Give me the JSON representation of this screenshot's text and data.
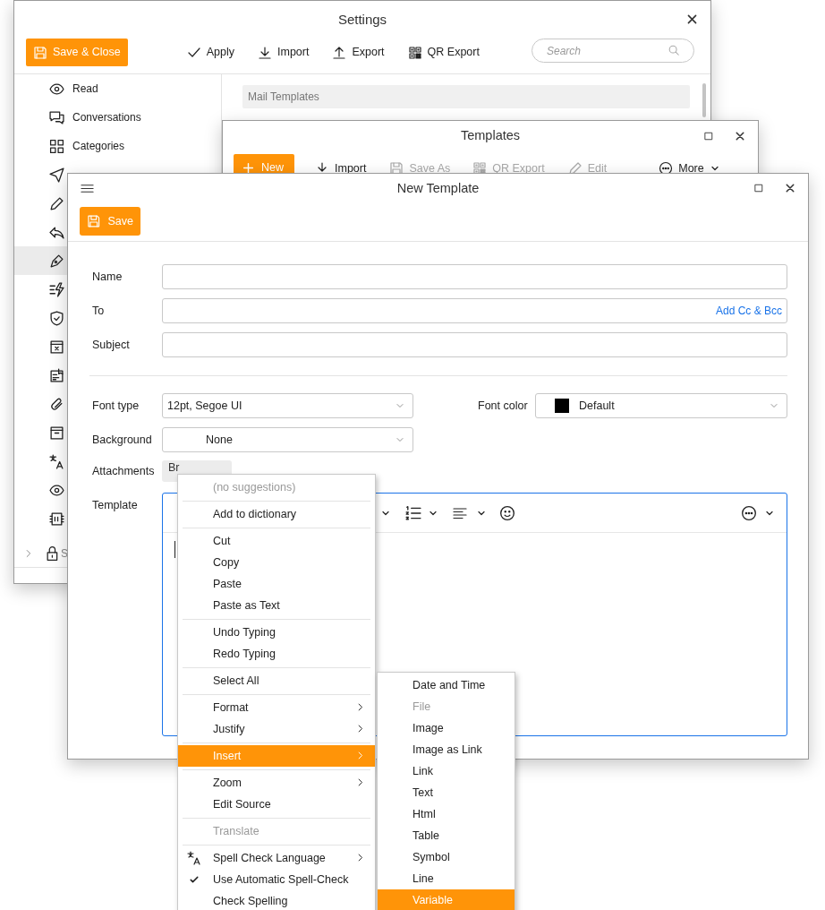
{
  "settings_window": {
    "title": "Settings",
    "save_button": "Save & Close",
    "toolbar": [
      "Apply",
      "Import",
      "Export",
      "QR Export"
    ],
    "search": {
      "placeholder": "Search"
    },
    "sidebar": {
      "items": [
        {
          "kind": "item",
          "label": "Read",
          "selected": false
        },
        {
          "kind": "item",
          "label": "Conversations",
          "selected": false
        },
        {
          "kind": "item",
          "label": "Categories",
          "selected": false
        },
        {
          "kind": "item",
          "selected": false
        },
        {
          "kind": "item",
          "selected": false
        },
        {
          "kind": "item",
          "selected": false
        },
        {
          "kind": "item",
          "selected": true
        },
        {
          "kind": "item",
          "selected": false
        },
        {
          "kind": "item",
          "selected": false
        },
        {
          "kind": "item",
          "selected": false
        },
        {
          "kind": "item",
          "selected": false
        },
        {
          "kind": "item",
          "selected": false
        },
        {
          "kind": "item",
          "selected": false
        },
        {
          "kind": "item",
          "selected": false
        },
        {
          "kind": "item",
          "selected": false
        },
        {
          "kind": "item",
          "selected": false
        },
        {
          "kind": "group",
          "label": "S",
          "selected": false
        }
      ]
    },
    "section_header": "Mail Templates"
  },
  "templates_window": {
    "title": "Templates",
    "new_button": "New",
    "toolbar": [
      {
        "label": "Import",
        "disabled": false
      },
      {
        "label": "Save As",
        "disabled": true
      },
      {
        "label": "QR Export",
        "disabled": true
      },
      {
        "label": "Edit",
        "disabled": true
      },
      {
        "label": "More",
        "disabled": false
      }
    ]
  },
  "new_template_window": {
    "title": "New Template",
    "save_button": "Save",
    "fields": [
      {
        "label": "Name"
      },
      {
        "label": "To",
        "link": "Add Cc & Bcc"
      },
      {
        "label": "Subject"
      }
    ],
    "font_type": {
      "label": "Font type",
      "value": "12pt, Segoe UI"
    },
    "font_color": {
      "label": "Font color",
      "value": "Default",
      "color": "#000000"
    },
    "background": {
      "label": "Background",
      "value": "None"
    },
    "attachments": {
      "label": "Attachments",
      "button": "Br"
    },
    "template": {
      "label": "Template"
    }
  },
  "context_menu": {
    "items": [
      {
        "kind": "item",
        "label": "(no suggestions)",
        "disabled": true,
        "selected": false,
        "checked": false,
        "submenu": false
      },
      {
        "kind": "separator"
      },
      {
        "kind": "item",
        "label": "Add to dictionary",
        "disabled": false,
        "selected": false,
        "checked": false,
        "submenu": false
      },
      {
        "kind": "separator"
      },
      {
        "kind": "item",
        "label": "Cut",
        "disabled": false,
        "selected": false,
        "checked": false,
        "submenu": false
      },
      {
        "kind": "item",
        "label": "Copy",
        "disabled": false,
        "selected": false,
        "checked": false,
        "submenu": false
      },
      {
        "kind": "item",
        "label": "Paste",
        "disabled": false,
        "selected": false,
        "checked": false,
        "submenu": false
      },
      {
        "kind": "item",
        "label": "Paste as Text",
        "disabled": false,
        "selected": false,
        "checked": false,
        "submenu": false
      },
      {
        "kind": "separator"
      },
      {
        "kind": "item",
        "label": "Undo Typing",
        "disabled": false,
        "selected": false,
        "checked": false,
        "submenu": false
      },
      {
        "kind": "item",
        "label": "Redo Typing",
        "disabled": false,
        "selected": false,
        "checked": false,
        "submenu": false
      },
      {
        "kind": "separator"
      },
      {
        "kind": "item",
        "label": "Select All",
        "disabled": false,
        "selected": false,
        "checked": false,
        "submenu": false
      },
      {
        "kind": "separator"
      },
      {
        "kind": "item",
        "label": "Format",
        "disabled": false,
        "selected": false,
        "checked": false,
        "submenu": true
      },
      {
        "kind": "item",
        "label": "Justify",
        "disabled": false,
        "selected": false,
        "checked": false,
        "submenu": true
      },
      {
        "kind": "separator"
      },
      {
        "kind": "item",
        "label": "Insert",
        "disabled": false,
        "selected": true,
        "checked": false,
        "submenu": true
      },
      {
        "kind": "separator"
      },
      {
        "kind": "item",
        "label": "Zoom",
        "disabled": false,
        "selected": false,
        "checked": false,
        "submenu": true
      },
      {
        "kind": "item",
        "label": "Edit Source",
        "disabled": false,
        "selected": false,
        "checked": false,
        "submenu": false
      },
      {
        "kind": "separator"
      },
      {
        "kind": "item",
        "label": "Translate",
        "disabled": true,
        "selected": false,
        "checked": false,
        "submenu": false
      },
      {
        "kind": "separator"
      },
      {
        "kind": "icon-item",
        "label": "Spell Check Language",
        "disabled": false,
        "selected": false,
        "checked": false,
        "submenu": true
      },
      {
        "kind": "item",
        "label": "Use Automatic Spell-Check",
        "disabled": false,
        "selected": false,
        "checked": true,
        "submenu": false
      },
      {
        "kind": "item",
        "label": "Check Spelling",
        "disabled": false,
        "selected": false,
        "checked": false,
        "submenu": false
      }
    ]
  },
  "insert_submenu": {
    "items": [
      {
        "label": "Date and Time",
        "disabled": false,
        "selected": false
      },
      {
        "label": "File",
        "disabled": true,
        "selected": false
      },
      {
        "label": "Image",
        "disabled": false,
        "selected": false
      },
      {
        "label": "Image as Link",
        "disabled": false,
        "selected": false
      },
      {
        "label": "Link",
        "disabled": false,
        "selected": false
      },
      {
        "label": "Text",
        "disabled": false,
        "selected": false
      },
      {
        "label": "Html",
        "disabled": false,
        "selected": false
      },
      {
        "label": "Table",
        "disabled": false,
        "selected": false
      },
      {
        "label": "Symbol",
        "disabled": false,
        "selected": false
      },
      {
        "label": "Line",
        "disabled": false,
        "selected": false
      },
      {
        "label": "Variable",
        "disabled": false,
        "selected": true
      }
    ]
  }
}
